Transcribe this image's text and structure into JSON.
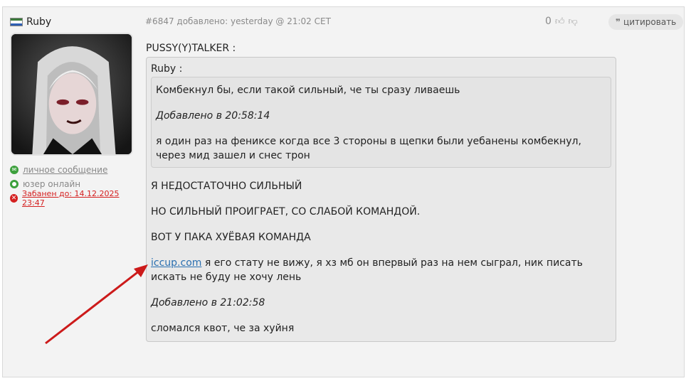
{
  "user": {
    "name": "Ruby",
    "flag_colors": [
      "#3a7a3a",
      "#ffffff",
      "#2f5fb3",
      "#d43030"
    ],
    "private_message": "личное сообщение",
    "online_status": "юзер онлайн",
    "ban_status": "Забанен до: 14.12.2025 23:47"
  },
  "post": {
    "id_line": "#6847 добавлено: yesterday @ 21:02 CET",
    "rating": "0",
    "quote_button": "цитировать",
    "author_line": "PUSSY(Y)TALKER :",
    "quote": {
      "author": "Ruby :",
      "inner": [
        "Комбекнул бы, если такой сильный, че ты сразу ливаешь",
        "Добавлено в 20:58:14",
        "я один раз на фениксе когда все 3 стороны в щепки были уебанены комбекнул, через мид зашел и снес трон"
      ]
    },
    "lines": [
      "Я НЕДОСТАТОЧНО СИЛЬНЫЙ",
      "НО СИЛЬНЫЙ ПРОИГРАЕТ, СО СЛАБОЙ КОМАНДОЙ.",
      "ВОТ У ПАКА ХУЁВАЯ КОМАНДА"
    ],
    "link_text": "iccup.com",
    "link_after": " я его стату не вижу, я хз мб он впервый раз на нем сыграл, ник писать искать не буду не хочу лень",
    "added_note": "Добавлено в 21:02:58",
    "last_line": "сломался квот, че за хуйня"
  },
  "colors": {
    "link": "#2a6fb0",
    "ban": "#d42020",
    "online": "#3ca03c",
    "arrow": "#cc1a1a"
  }
}
